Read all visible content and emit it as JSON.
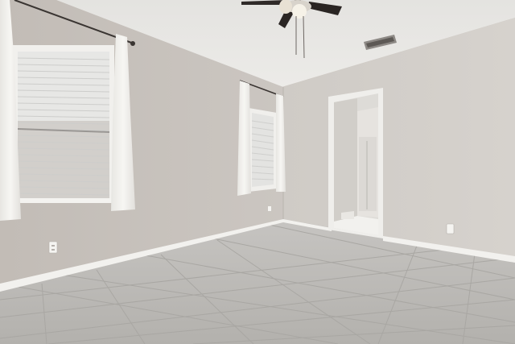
{
  "scene": {
    "description_type": "empty-bedroom-photo",
    "colors": {
      "ceiling": "#e9e8e5",
      "left_wall": "#c9c3bd",
      "right_wall": "#d3cfca",
      "far_wall": "#cbc6c0",
      "floor": "#b9b7b3",
      "grout": "#a5a39f",
      "baseboard": "#f2f1ee",
      "curtain": "#f3f2ef",
      "window_glass": "#e6e6e4",
      "door_trim": "#f0efec",
      "fan_body": "#2b2624",
      "fan_light": "#f3efe6"
    },
    "objects": [
      "ceiling-fan",
      "air-vent",
      "left-window",
      "far-window",
      "bathroom-doorway",
      "electrical-outlet-left",
      "electrical-outlet-right",
      "tile-floor"
    ]
  }
}
